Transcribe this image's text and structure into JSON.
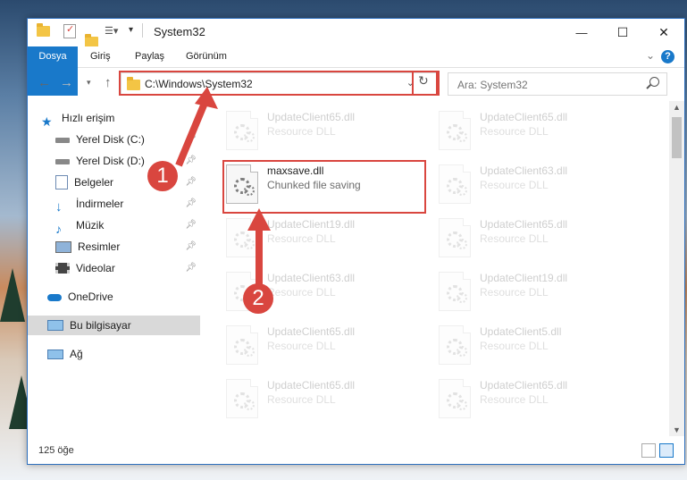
{
  "window": {
    "title": "System32",
    "controls": {
      "minimize": "—",
      "maximize": "☐",
      "close": "✕"
    }
  },
  "ribbon": {
    "tabs": [
      "Dosya",
      "Giriş",
      "Paylaş",
      "Görünüm"
    ],
    "help": "?"
  },
  "address": {
    "path": "C:\\Windows\\System32",
    "search_placeholder": "Ara: System32"
  },
  "sidebar": {
    "items": [
      {
        "label": "Hızlı erişim",
        "icon": "star-icon",
        "pinned": false
      },
      {
        "label": "Yerel Disk (C:)",
        "icon": "drive-icon",
        "pinned": true
      },
      {
        "label": "Yerel Disk (D:)",
        "icon": "drive-icon",
        "pinned": true
      },
      {
        "label": "Belgeler",
        "icon": "documents-icon",
        "pinned": true
      },
      {
        "label": "İndirmeler",
        "icon": "download-icon",
        "pinned": true
      },
      {
        "label": "Müzik",
        "icon": "music-icon",
        "pinned": true
      },
      {
        "label": "Resimler",
        "icon": "pictures-icon",
        "pinned": true
      },
      {
        "label": "Videolar",
        "icon": "videos-icon",
        "pinned": true
      },
      {
        "label": "OneDrive",
        "icon": "cloud-icon",
        "pinned": false
      },
      {
        "label": "Bu bilgisayar",
        "icon": "computer-icon",
        "pinned": false,
        "selected": true
      },
      {
        "label": "Ağ",
        "icon": "network-icon",
        "pinned": false
      }
    ]
  },
  "files": [
    {
      "name": "UpdateClient65.dll",
      "desc": "Resource DLL",
      "faded": true
    },
    {
      "name": "UpdateClient65.dll",
      "desc": "Resource DLL",
      "faded": true
    },
    {
      "name": "maxsave.dll",
      "desc": "Chunked file saving",
      "faded": false
    },
    {
      "name": "UpdateClient63.dll",
      "desc": "Resource DLL",
      "faded": true
    },
    {
      "name": "UpdateClient19.dll",
      "desc": "Resource DLL",
      "faded": true
    },
    {
      "name": "UpdateClient65.dll",
      "desc": "Resource DLL",
      "faded": true
    },
    {
      "name": "UpdateClient63.dll",
      "desc": "Resource DLL",
      "faded": true
    },
    {
      "name": "UpdateClient19.dll",
      "desc": "Resource DLL",
      "faded": true
    },
    {
      "name": "UpdateClient65.dll",
      "desc": "Resource DLL",
      "faded": true
    },
    {
      "name": "UpdateClient5.dll",
      "desc": "Resource DLL",
      "faded": true
    },
    {
      "name": "UpdateClient65.dll",
      "desc": "Resource DLL",
      "faded": true
    },
    {
      "name": "UpdateClient65.dll",
      "desc": "Resource DLL",
      "faded": true
    }
  ],
  "status": {
    "count": "125 öğe"
  },
  "markers": [
    "1",
    "2"
  ],
  "colors": {
    "accent": "#1979ca",
    "highlight": "#d9463f"
  }
}
